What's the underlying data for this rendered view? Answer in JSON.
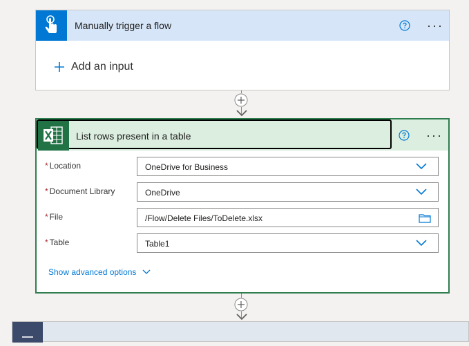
{
  "trigger": {
    "title": "Manually trigger a flow",
    "add_input_label": "Add an input",
    "icon": "hand-touch-icon",
    "accent_color": "#0078d4",
    "header_color": "#d6e6f8"
  },
  "action": {
    "title": "List rows present in a table",
    "icon": "excel-icon",
    "accent_color": "#217346",
    "header_color": "#dbeedf",
    "fields": [
      {
        "label": "Location",
        "required": true,
        "value": "OneDrive for Business",
        "control": "dropdown"
      },
      {
        "label": "Document Library",
        "required": true,
        "value": "OneDrive",
        "control": "dropdown"
      },
      {
        "label": "File",
        "required": true,
        "value": "/Flow/Delete Files/ToDelete.xlsx",
        "control": "file-picker"
      },
      {
        "label": "Table",
        "required": true,
        "value": "Table1",
        "control": "dropdown"
      }
    ],
    "advanced_label": "Show advanced options"
  },
  "ui": {
    "required_marker": "*",
    "help_icon": "question-circle-icon",
    "more_icon": "ellipsis-icon",
    "more_glyph": "···"
  }
}
